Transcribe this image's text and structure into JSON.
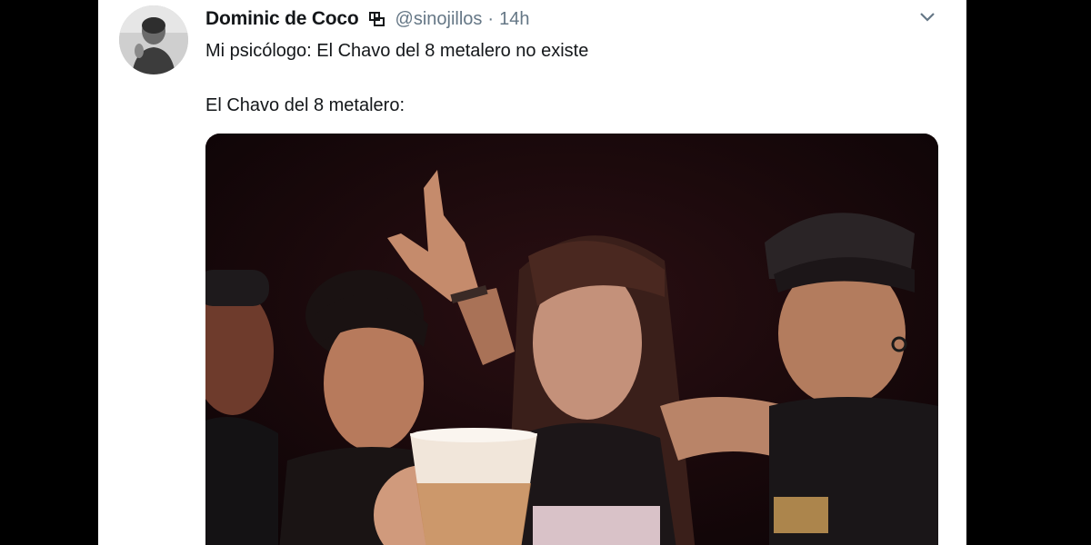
{
  "tweet": {
    "display_name": "Dominic de Coco",
    "handle": "@sinojillos",
    "separator": "·",
    "time": "14h",
    "text_line_1": "Mi psicólogo: El Chavo del 8 metalero no existe",
    "text_line_2": "El Chavo del 8 metalero:"
  },
  "icons": {
    "bot": "bot-account-icon",
    "caret": "chevron-down-icon"
  },
  "colors": {
    "name": "#14171a",
    "secondary": "#657786",
    "card_background": "#ffffff",
    "page_background": "#000000"
  }
}
